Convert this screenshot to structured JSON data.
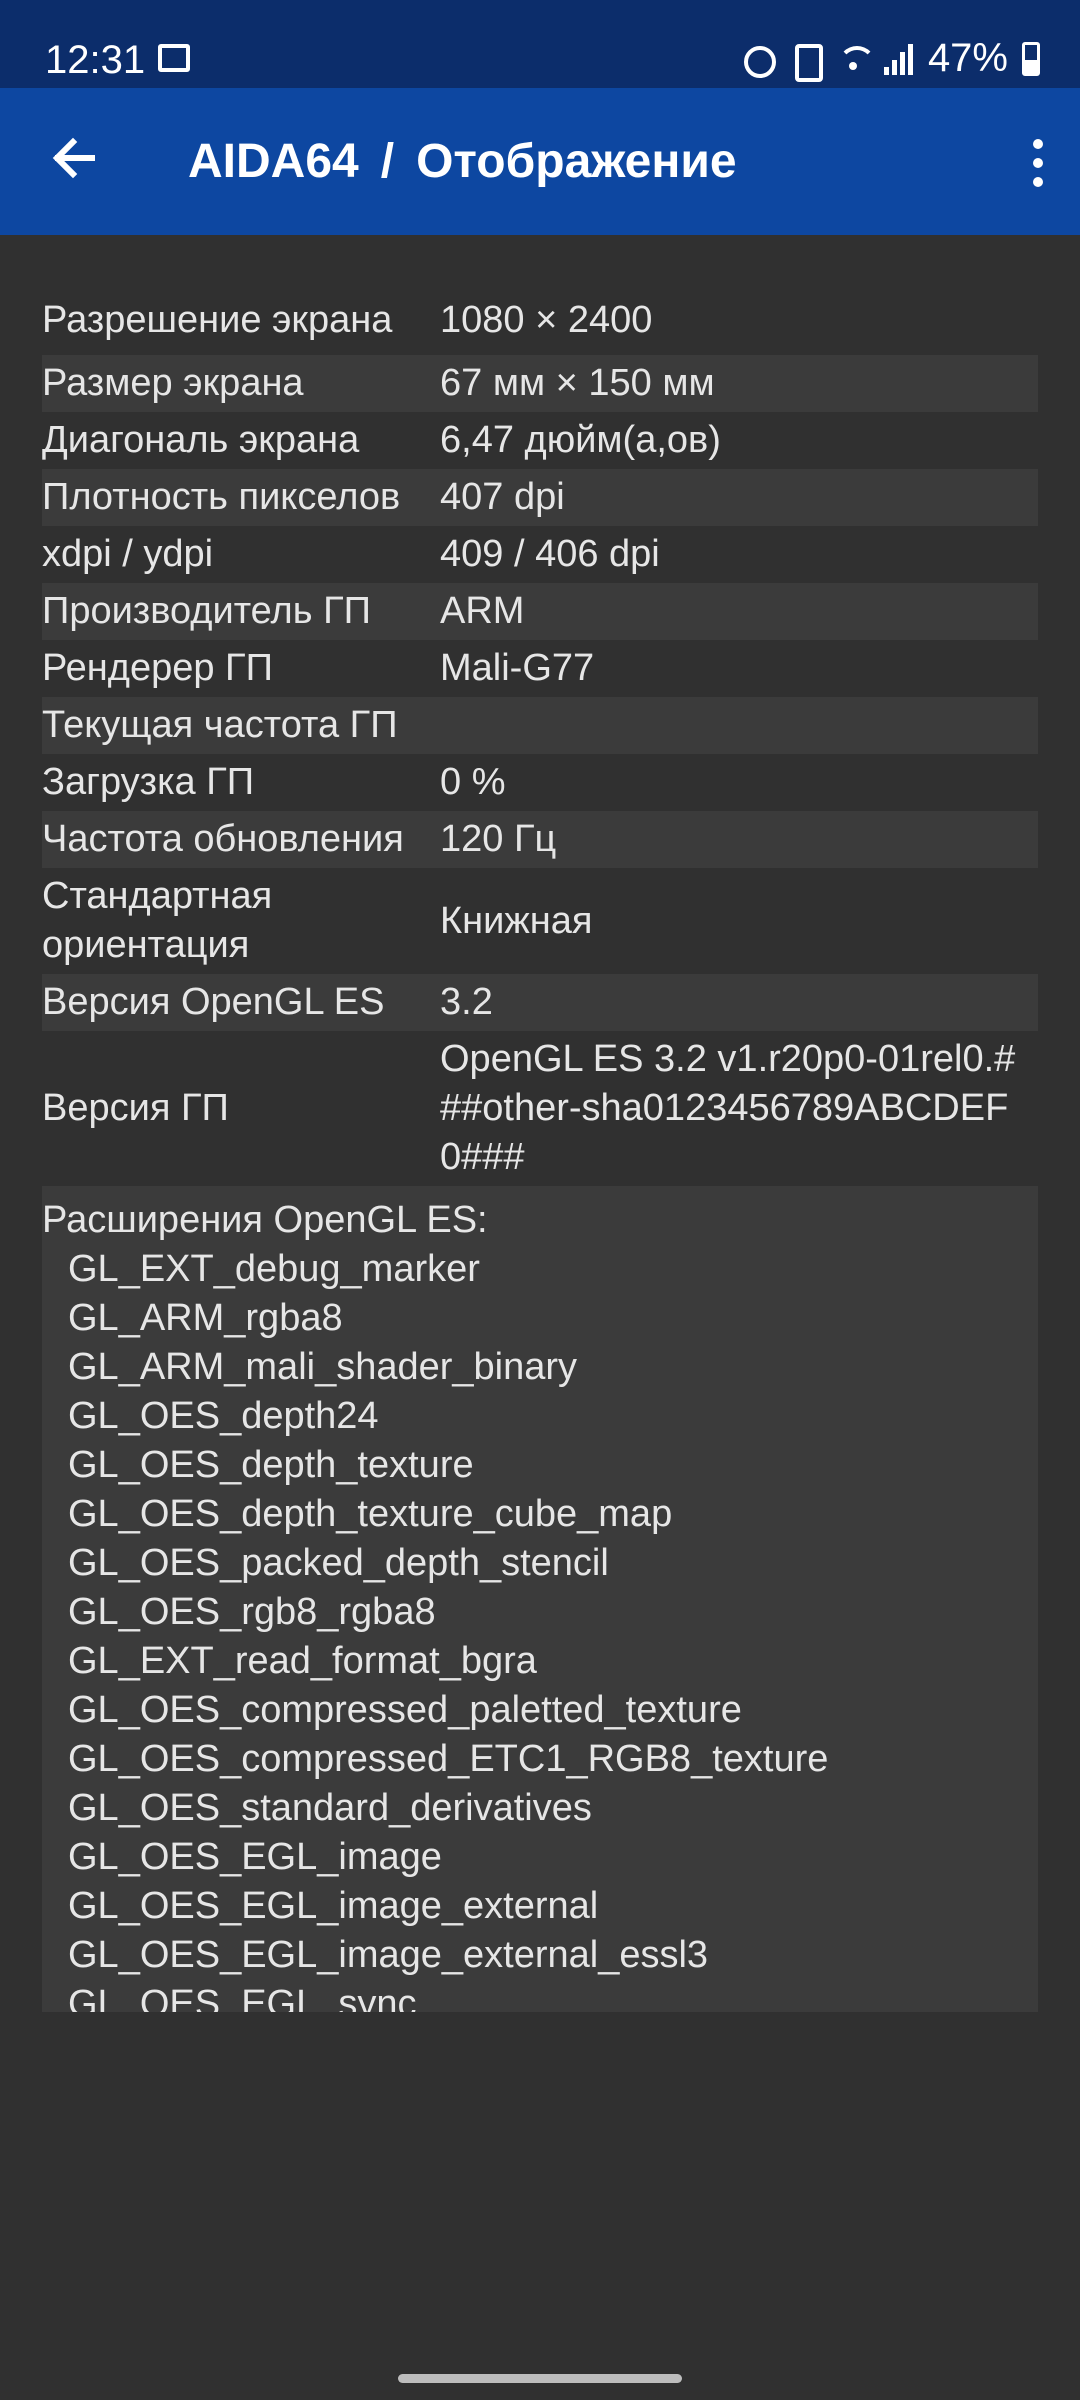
{
  "status": {
    "time": "12:31",
    "battery": "47%"
  },
  "app_bar": {
    "app": "AIDA64",
    "separator": "/",
    "section": "Отображение"
  },
  "rows": [
    {
      "label": "Разрешение экрана",
      "value": "1080 × 2400"
    },
    {
      "label": "Размер экрана",
      "value": "67 мм × 150 мм"
    },
    {
      "label": "Диагональ экрана",
      "value": "6,47 дюйм(а,ов)"
    },
    {
      "label": "Плотность пикселов",
      "value": "407 dpi"
    },
    {
      "label": "xdpi / ydpi",
      "value": "409 / 406 dpi"
    },
    {
      "label": "Производитель ГП",
      "value": "ARM"
    },
    {
      "label": "Рендерер ГП",
      "value": "Mali-G77"
    },
    {
      "label": "Текущая частота ГП",
      "value": ""
    },
    {
      "label": "Загрузка ГП",
      "value": "0 %"
    },
    {
      "label": "Частота обновления",
      "value": "120 Гц"
    },
    {
      "label": "Стандартная ориентация",
      "value": "Книжная"
    },
    {
      "label": "Версия OpenGL ES",
      "value": "3.2"
    },
    {
      "label": "Версия ГП",
      "value": "OpenGL ES 3.2 v1.r20p0-01rel0.###other-sha0123456789ABCDEF0###"
    }
  ],
  "extensions": {
    "title": "Расширения OpenGL ES:",
    "items": [
      "GL_EXT_debug_marker",
      "GL_ARM_rgba8",
      "GL_ARM_mali_shader_binary",
      "GL_OES_depth24",
      "GL_OES_depth_texture",
      "GL_OES_depth_texture_cube_map",
      "GL_OES_packed_depth_stencil",
      "GL_OES_rgb8_rgba8",
      "GL_EXT_read_format_bgra",
      "GL_OES_compressed_paletted_texture",
      "GL_OES_compressed_ETC1_RGB8_texture",
      "GL_OES_standard_derivatives",
      "GL_OES_EGL_image",
      "GL_OES_EGL_image_external",
      "GL_OES_EGL_image_external_essl3",
      "GL_OES_EGL_sync"
    ]
  }
}
